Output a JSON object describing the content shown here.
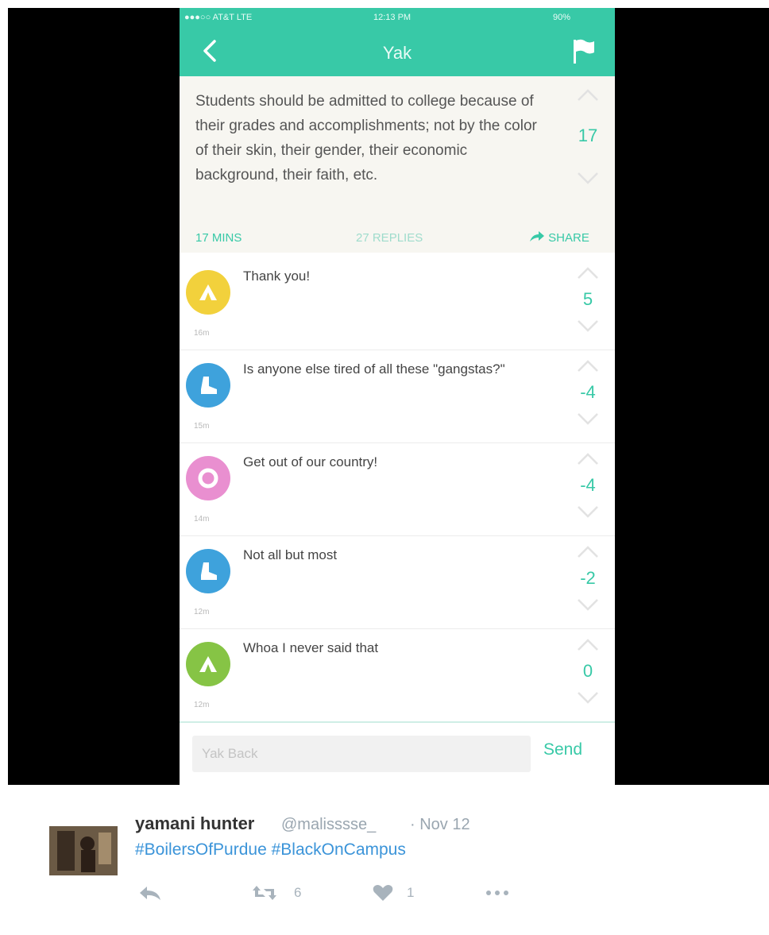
{
  "status_bar": {
    "carrier": "●●●○○ AT&T LTE",
    "time": "12:13 PM",
    "battery": "90%"
  },
  "header": {
    "title": "Yak",
    "back_icon": "chevron-left-icon",
    "flag_icon": "flag-icon",
    "color": "#38c9a7"
  },
  "post": {
    "text": "Students should be admitted to college because of their grades and accomplishments; not by the color of their skin, their gender, their economic background, their faith, etc.",
    "votes": "17",
    "time": "17 MINS",
    "replies": "27 REPLIES",
    "share_label": "SHARE"
  },
  "replies": [
    {
      "text": "Thank you!",
      "time": "16m",
      "votes": "5",
      "avatar_color": "#f2d13c",
      "icon": "tent-icon"
    },
    {
      "text": "Is anyone else tired of all these \"gangstas?\"",
      "time": "15m",
      "votes": "-4",
      "avatar_color": "#3ea2dc",
      "icon": "boot-icon"
    },
    {
      "text": "Get out of our country!",
      "time": "14m",
      "votes": "-4",
      "avatar_color": "#e98fd0",
      "icon": "life-ring-icon"
    },
    {
      "text": "Not all but most",
      "time": "12m",
      "votes": "-2",
      "avatar_color": "#3ea2dc",
      "icon": "boot-icon"
    },
    {
      "text": "Whoa I never said that",
      "time": "12m",
      "votes": "0",
      "avatar_color": "#86c445",
      "icon": "tent-icon"
    }
  ],
  "reply_box": {
    "placeholder": "Yak Back",
    "send_label": "Send"
  },
  "tweet": {
    "name": "yamani hunter",
    "handle": "@malisssse_",
    "date": "· Nov 12",
    "hashtags": [
      "#BoilersOfPurdue",
      "#BlackOnCampus"
    ],
    "retweets": "6",
    "likes": "1"
  }
}
